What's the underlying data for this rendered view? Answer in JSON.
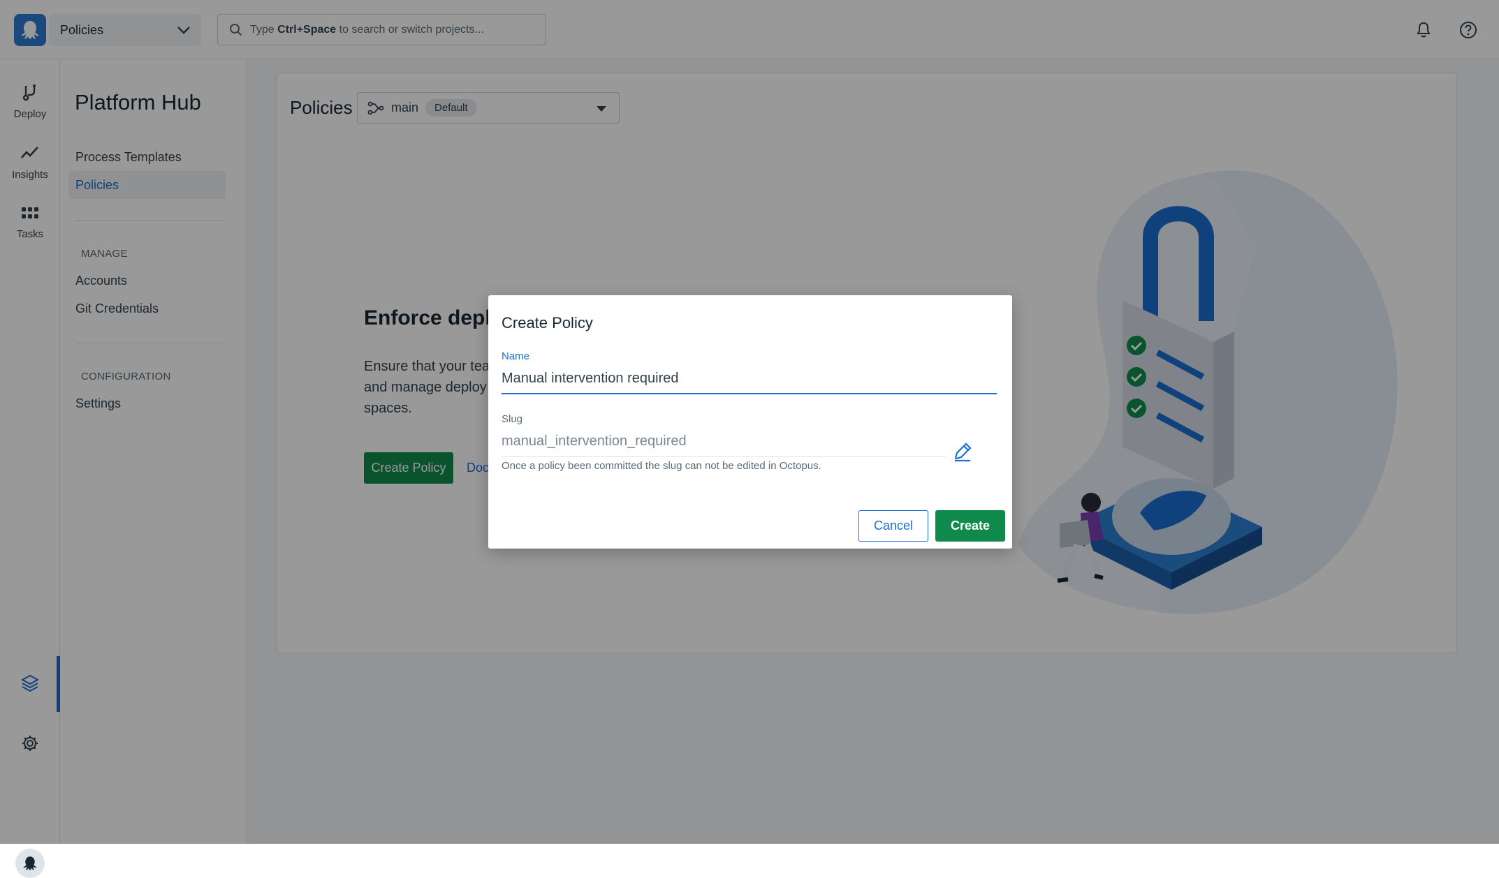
{
  "topbar": {
    "project_select": "Policies",
    "search_prefix": "Type ",
    "search_shortcut": "Ctrl+Space",
    "search_suffix": " to search or switch projects..."
  },
  "rail": {
    "items": [
      {
        "label": "Deploy",
        "icon": "deploy-icon"
      },
      {
        "label": "Insights",
        "icon": "insights-icon"
      },
      {
        "label": "Tasks",
        "icon": "tasks-icon"
      }
    ]
  },
  "sidebar": {
    "title": "Platform Hub",
    "items": [
      "Process Templates",
      "Policies"
    ],
    "manage_heading": "MANAGE",
    "manage_items": [
      "Accounts",
      "Git Credentials"
    ],
    "config_heading": "CONFIGURATION",
    "config_items": [
      "Settings"
    ]
  },
  "main": {
    "title": "Policies",
    "branch": "main",
    "branch_badge": "Default",
    "enforce_title": "Enforce deplo",
    "enforce_desc_1": "Ensure that your tea",
    "enforce_desc_2": "and manage deploy",
    "enforce_desc_3": "spaces.",
    "create_policy_label": "Create Policy",
    "docs_label": "Doc"
  },
  "dialog": {
    "title": "Create Policy",
    "name_label": "Name",
    "name_value": "Manual intervention required",
    "slug_label": "Slug",
    "slug_value": "manual_intervention_required",
    "slug_help": "Once a policy been committed the slug can not be edited in Octopus.",
    "cancel_label": "Cancel",
    "create_label": "Create"
  },
  "colors": {
    "accent": "#1a6fd0",
    "primary_button": "#0f8a4b",
    "overlay": "rgba(0,0,0,0.40)"
  }
}
